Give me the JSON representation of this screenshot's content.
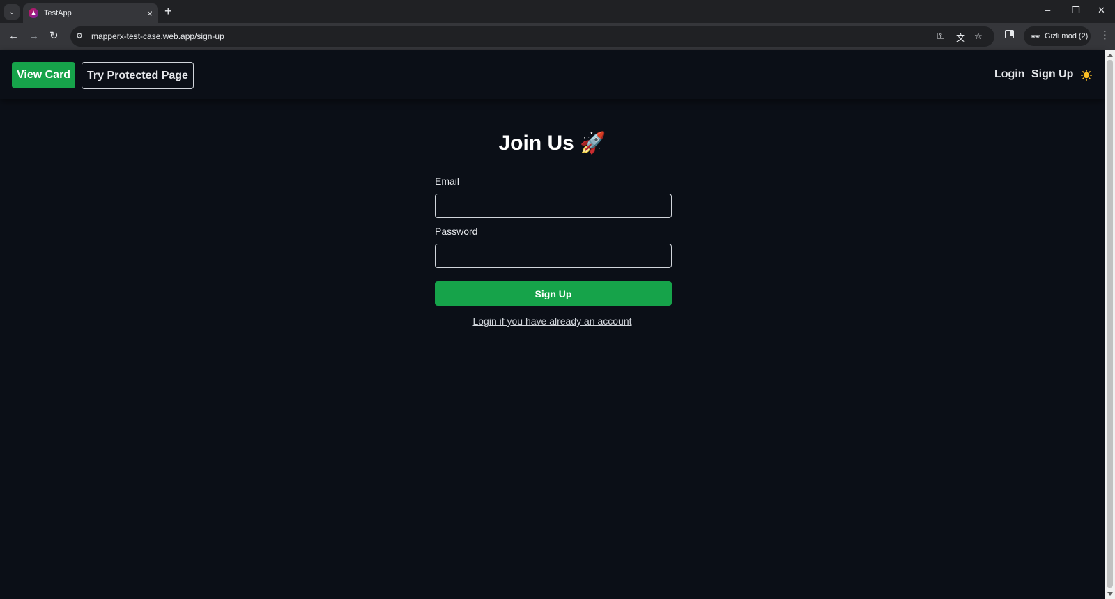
{
  "browser": {
    "tab_title": "TestApp",
    "url": "mapperx-test-case.web.app/sign-up",
    "incognito_label": "Gizli mod (2)"
  },
  "navbar": {
    "view_card": "View Card",
    "try_protected": "Try Protected Page",
    "login": "Login",
    "sign_up": "Sign Up",
    "theme_icon": "sun-icon"
  },
  "form": {
    "title": "Join Us 🚀",
    "email_label": "Email",
    "email_value": "",
    "password_label": "Password",
    "password_value": "",
    "submit_label": "Sign Up",
    "login_link": "Login if you have already an account"
  },
  "colors": {
    "background": "#0b0f17",
    "accent": "#16a34a",
    "sun": "#fbbf24"
  }
}
